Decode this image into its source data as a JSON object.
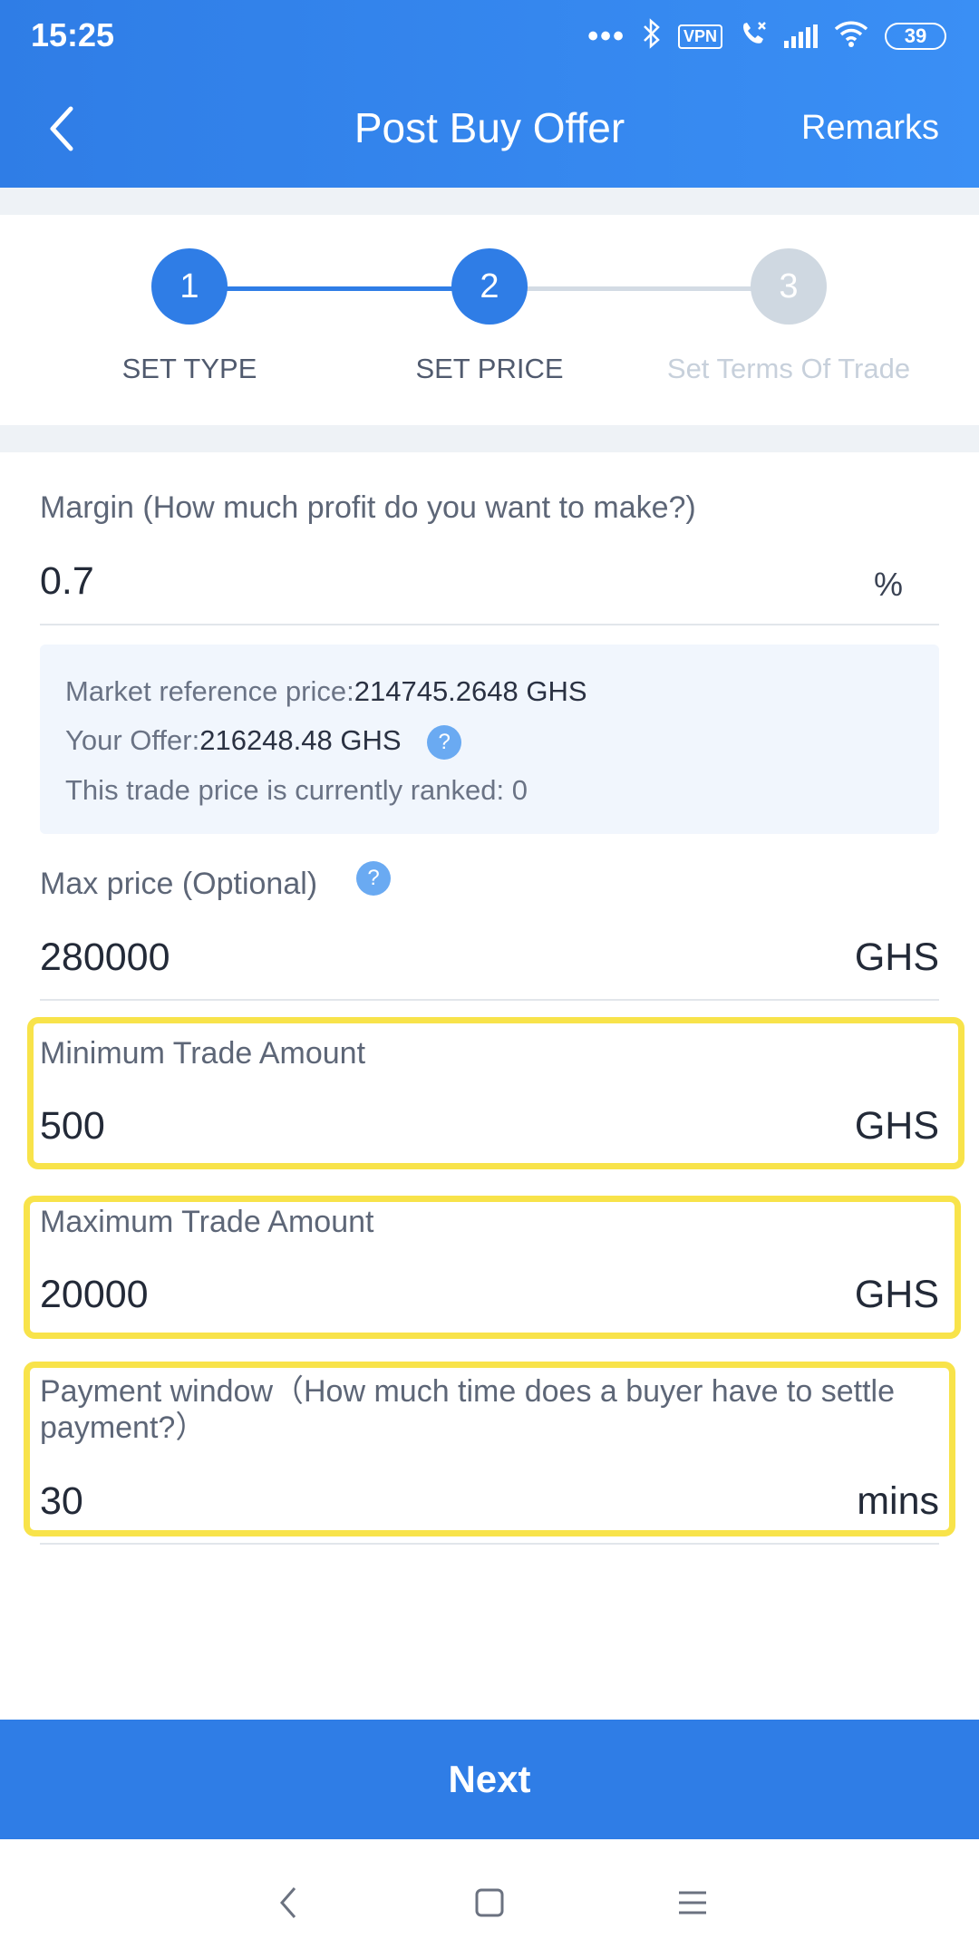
{
  "status": {
    "time": "15:25",
    "vpn": "VPN",
    "battery": "39"
  },
  "header": {
    "title": "Post Buy Offer",
    "remarks": "Remarks"
  },
  "steps": [
    {
      "number": "1",
      "label": "SET TYPE"
    },
    {
      "number": "2",
      "label": "SET PRICE"
    },
    {
      "number": "3",
      "label": "Set Terms Of Trade"
    }
  ],
  "margin": {
    "label": "Margin (How much profit do you want to make?)",
    "value": "0.7",
    "unit": "%"
  },
  "info": {
    "market_label": "Market reference price:",
    "market_value": "214745.2648 GHS",
    "offer_label": "Your Offer:",
    "offer_value": "216248.48 GHS",
    "help_mark": "?",
    "rank_text": "This trade price is currently ranked: 0"
  },
  "max_price": {
    "label": "Max price (Optional)",
    "help_mark": "?",
    "value": "280000",
    "unit": "GHS"
  },
  "min_trade": {
    "label": "Minimum Trade Amount",
    "value": "500",
    "unit": "GHS"
  },
  "max_trade": {
    "label": "Maximum Trade Amount",
    "value": "20000",
    "unit": "GHS"
  },
  "payment_window": {
    "label": "Payment window（How much time does a buyer have to settle payment?）",
    "value": "30",
    "unit": "mins"
  },
  "next_button": "Next",
  "colors": {
    "primary": "#2f7de6",
    "highlight": "#f8e34a",
    "inactive": "#cfd8e1",
    "info_bg": "#f1f6fd"
  }
}
